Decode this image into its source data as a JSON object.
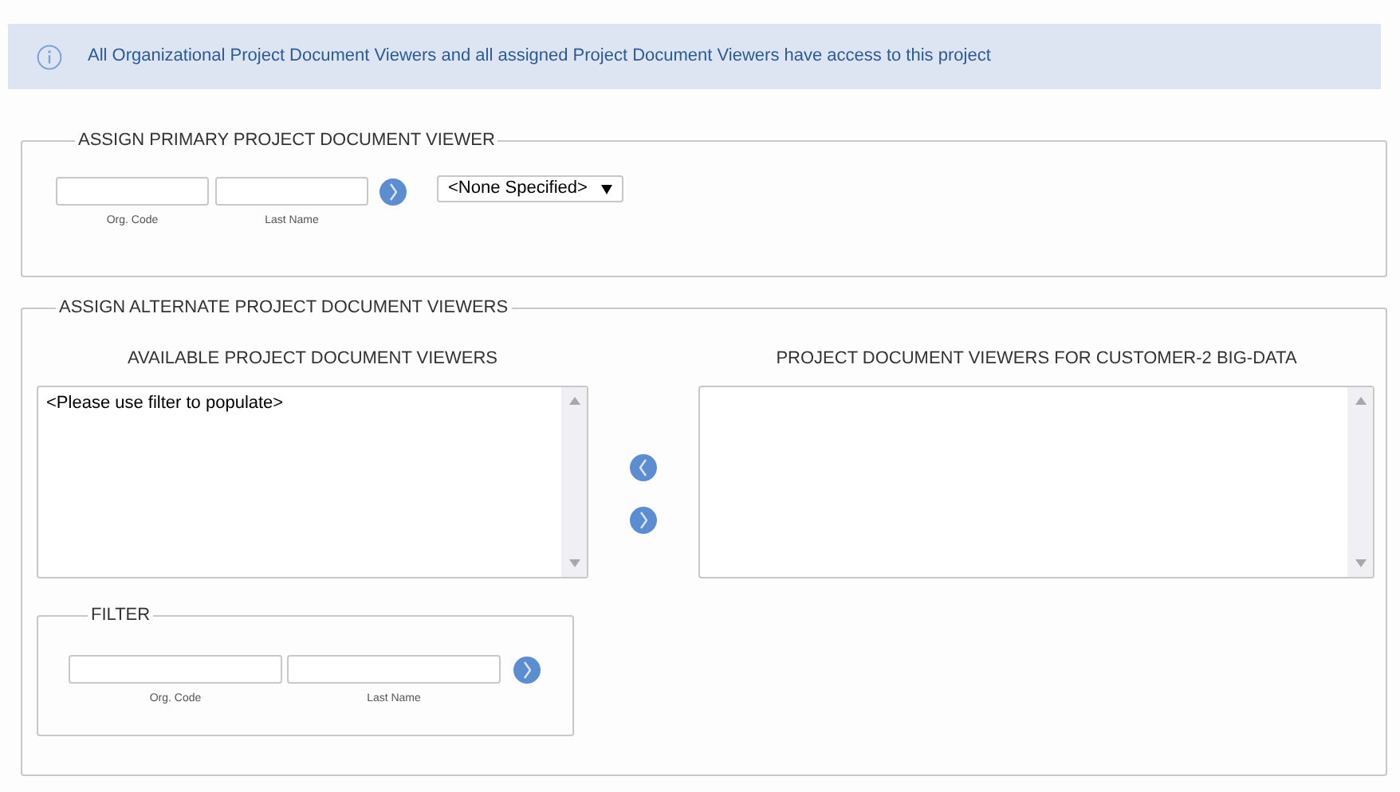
{
  "info_banner": {
    "text": "All Organizational Project Document Viewers and all assigned Project Document Viewers have access to this project"
  },
  "primary_viewer": {
    "title": "ASSIGN PRIMARY PROJECT DOCUMENT VIEWER",
    "fields": [
      {
        "label": "Org. Code"
      },
      {
        "label": "Last Name"
      }
    ],
    "select": {
      "value": "<None Specified>"
    }
  },
  "alternate_viewers": {
    "title": "ASSIGN ALTERNATE PROJECT DOCUMENT VIEWERS",
    "available": {
      "heading": "AVAILABLE PROJECT DOCUMENT VIEWERS",
      "items": [
        "<Please use filter to populate>"
      ]
    },
    "assigned": {
      "heading": "PROJECT DOCUMENT VIEWERS FOR CUSTOMER-2 BIG-DATA"
    },
    "filter": {
      "title": "FILTER",
      "fields": [
        {
          "label": "Org. Code"
        },
        {
          "label": "Last Name"
        }
      ]
    }
  }
}
